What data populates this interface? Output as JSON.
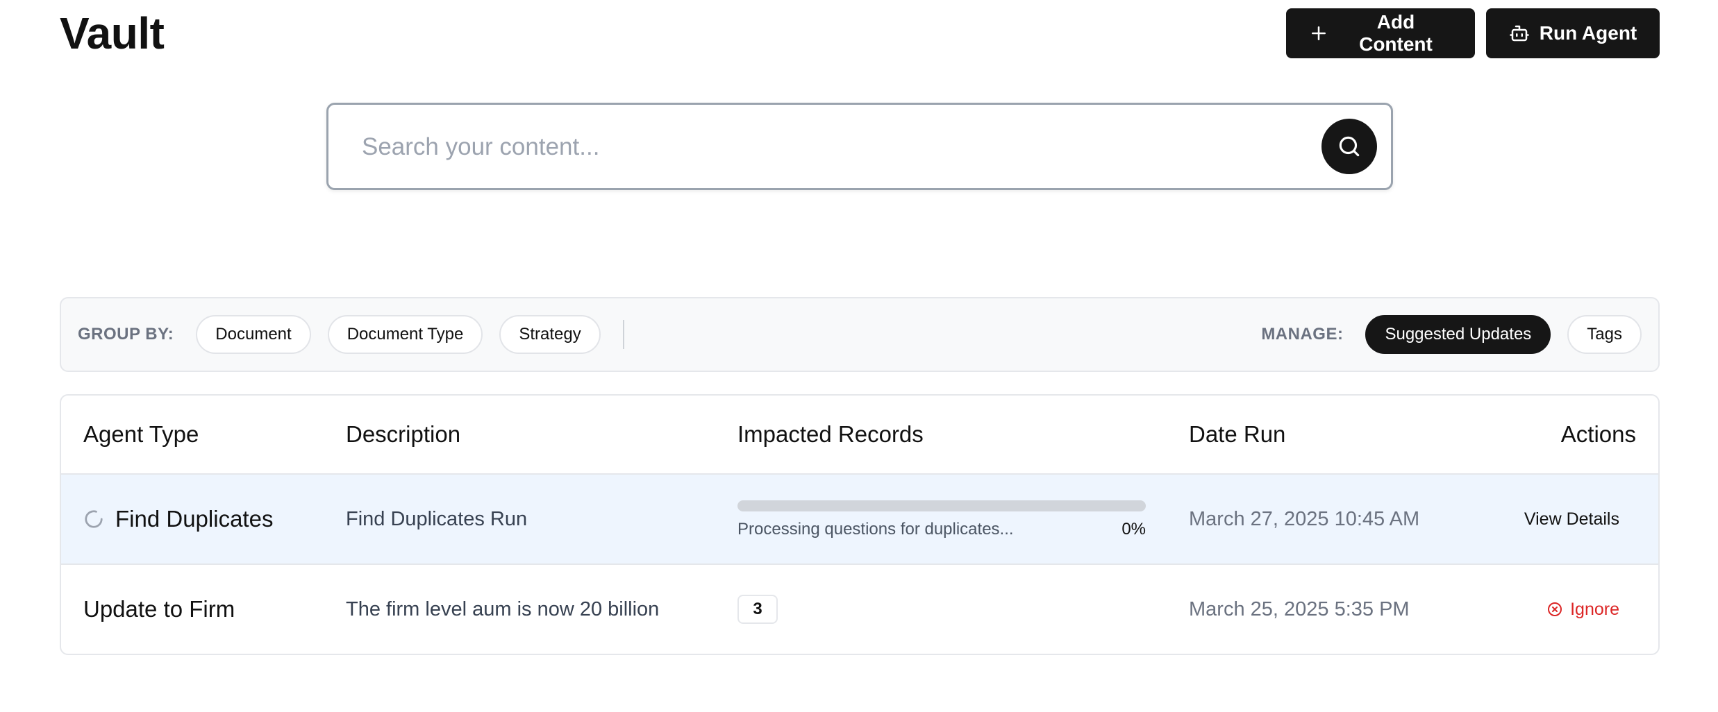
{
  "header": {
    "title": "Vault",
    "add_content_label": "Add Content",
    "run_agent_label": "Run Agent"
  },
  "search": {
    "placeholder": "Search your content..."
  },
  "toolbar": {
    "group_by_label": "GROUP BY:",
    "group_by_options": [
      "Document",
      "Document Type",
      "Strategy"
    ],
    "manage_label": "MANAGE:",
    "manage_options": [
      "Suggested Updates",
      "Tags"
    ],
    "active_manage": "Suggested Updates"
  },
  "table": {
    "columns": [
      "Agent Type",
      "Description",
      "Impacted Records",
      "Date Run",
      "Actions"
    ],
    "rows": [
      {
        "agent_type": "Find Duplicates",
        "description": "Find Duplicates Run",
        "progress_status": "Processing questions for duplicates...",
        "progress_percent_label": "0%",
        "progress_fraction": 0,
        "date_run": "March 27, 2025 10:45 AM",
        "action_label": "View Details"
      },
      {
        "agent_type": "Update to Firm",
        "description": "The firm level aum is now 20 billion",
        "impacted_count": "3",
        "date_run": "March 25, 2025 5:35 PM",
        "action_label": "Ignore"
      }
    ]
  },
  "colors": {
    "primary_dark": "#161616",
    "highlight_row": "#eef5fe",
    "danger": "#dc2626"
  },
  "icons": {
    "add_content": "plus-icon",
    "run_agent": "robot-icon",
    "search": "search-icon",
    "loading": "spinner-icon",
    "ignore": "x-circle-icon"
  }
}
